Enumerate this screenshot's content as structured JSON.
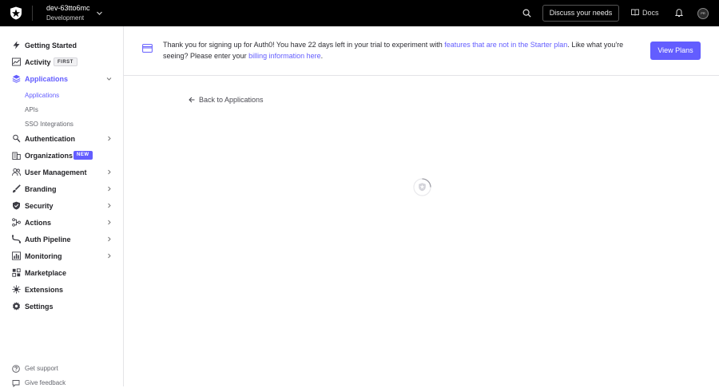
{
  "topbar": {
    "tenant_name": "dev-63tto6mc",
    "tenant_env": "Development",
    "discuss_button": "Discuss your needs",
    "docs_label": "Docs",
    "avatar_initials": "PR"
  },
  "sidebar": {
    "items": [
      {
        "label": "Getting Started",
        "icon": "lightning-icon"
      },
      {
        "label": "Activity",
        "icon": "activity-chart-icon",
        "badge": "FIRST"
      },
      {
        "label": "Applications",
        "icon": "layers-icon",
        "expanded": true
      },
      {
        "label": "Authentication",
        "icon": "auth-icon"
      },
      {
        "label": "Organizations",
        "icon": "building-icon",
        "badge": "NEW"
      },
      {
        "label": "User Management",
        "icon": "users-icon"
      },
      {
        "label": "Branding",
        "icon": "brush-icon"
      },
      {
        "label": "Security",
        "icon": "shield-icon"
      },
      {
        "label": "Actions",
        "icon": "actions-icon"
      },
      {
        "label": "Auth Pipeline",
        "icon": "pipeline-icon"
      },
      {
        "label": "Monitoring",
        "icon": "monitoring-icon"
      },
      {
        "label": "Marketplace",
        "icon": "marketplace-icon"
      },
      {
        "label": "Extensions",
        "icon": "extensions-icon"
      },
      {
        "label": "Settings",
        "icon": "gear-icon"
      }
    ],
    "sub_items": [
      "Applications",
      "APIs",
      "SSO Integrations"
    ],
    "footer": {
      "support": "Get support",
      "feedback": "Give feedback"
    }
  },
  "banner": {
    "text_1": "Thank you for signing up for Auth0! You have 22 days left in your trial to experiment with ",
    "link_1": "features that are not in the Starter plan",
    "text_2": ". Like what you're seeing? Please enter your ",
    "link_2": "billing information here",
    "text_3": ".",
    "button": "View Plans"
  },
  "main": {
    "back_link": "Back to Applications"
  },
  "colors": {
    "accent": "#635dff",
    "topbar": "#000000"
  }
}
